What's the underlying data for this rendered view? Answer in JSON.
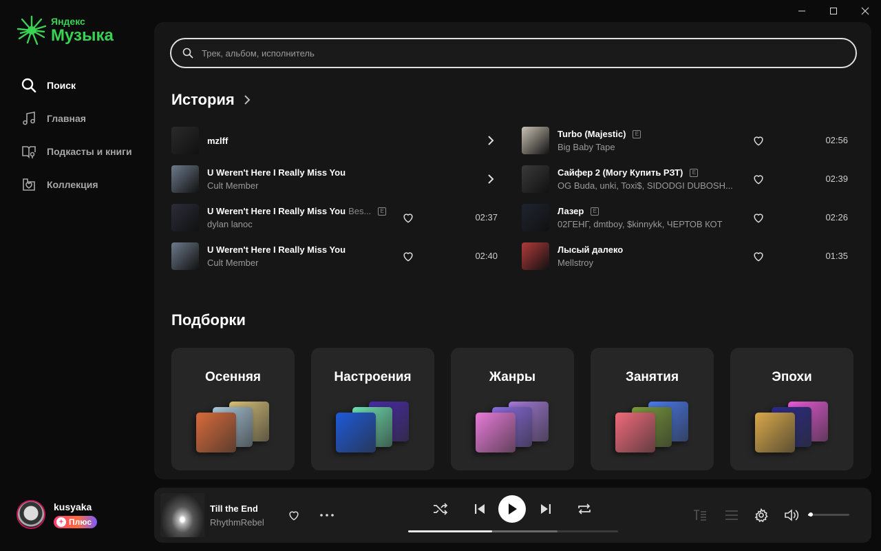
{
  "logo": {
    "small": "Яндекс",
    "big": "Музыка"
  },
  "nav": [
    {
      "label": "Поиск",
      "icon": "search-icon",
      "active": true
    },
    {
      "label": "Главная",
      "icon": "music-note-icon",
      "active": false
    },
    {
      "label": "Подкасты и книги",
      "icon": "book-mic-icon",
      "active": false
    },
    {
      "label": "Коллекция",
      "icon": "heart-folder-icon",
      "active": false
    }
  ],
  "user": {
    "name": "kusyaka",
    "badge": "Плюс"
  },
  "search": {
    "placeholder": "Трек, альбом, исполнитель"
  },
  "history": {
    "title": "История",
    "tracks": [
      {
        "title": "mzlff",
        "feat": "",
        "artist": "",
        "explicit": false,
        "duration": "",
        "type": "artist",
        "cover": "#2a2a2a"
      },
      {
        "title": "U Weren't Here I Really Miss You",
        "feat": "",
        "artist": "Cult Member",
        "explicit": false,
        "duration": "",
        "type": "album",
        "cover": "#6c7a8a"
      },
      {
        "title": "U Weren't Here I Really Miss You",
        "feat": "Bes...",
        "artist": "dylan lanoc",
        "explicit": true,
        "duration": "02:37",
        "type": "track",
        "cover": "#2b2d3a"
      },
      {
        "title": "U Weren't Here I Really Miss You",
        "feat": "",
        "artist": "Cult Member",
        "explicit": false,
        "duration": "02:40",
        "type": "track",
        "cover": "#6c7a8a"
      },
      {
        "title": "Turbo (Majestic)",
        "feat": "",
        "artist": "Big Baby Tape",
        "explicit": true,
        "duration": "02:56",
        "type": "track",
        "cover": "#c9c2b3"
      },
      {
        "title": "Сайфер 2 (Могу Купить РЗТ)",
        "feat": "",
        "artist": "OG Buda, unki, Toxi$, SIDODGI DUBOSH...",
        "explicit": true,
        "duration": "02:39",
        "type": "track",
        "cover": "#3a3a3a"
      },
      {
        "title": "Лазер",
        "feat": "",
        "artist": "02ГЕНГ, dmtboy, $kinnykk, ЧЕРТОВ КОТ",
        "explicit": true,
        "duration": "02:26",
        "type": "track",
        "cover": "#1e2430"
      },
      {
        "title": "Лысый далеко",
        "feat": "",
        "artist": "Mellstroy",
        "explicit": false,
        "duration": "01:35",
        "type": "track",
        "cover": "#b23a3a"
      }
    ]
  },
  "selections": {
    "title": "Подборки",
    "cards": [
      {
        "title": "Осенняя",
        "tiles": [
          "#d8c27a",
          "#a9c6d8",
          "#d86a3a"
        ]
      },
      {
        "title": "Настроения",
        "tiles": [
          "#4a2aa8",
          "#6fe0b0",
          "#1e5ad8"
        ]
      },
      {
        "title": "Жанры",
        "tiles": [
          "#a47ad8",
          "#8a6ae0",
          "#e87ad8"
        ]
      },
      {
        "title": "Занятия",
        "tiles": [
          "#4a7af0",
          "#7a9a3a",
          "#f06a7a"
        ]
      },
      {
        "title": "Эпохи",
        "tiles": [
          "#e85ad8",
          "#2a2a8a",
          "#d8a84a"
        ]
      }
    ]
  },
  "player": {
    "title": "Till the End",
    "artist": "RhythmRebel",
    "progress": 0.4,
    "buffered": 0.71,
    "volume": 0.06
  },
  "colors": {
    "accent": "#39d353",
    "panel": "#161616",
    "card": "#262626"
  }
}
